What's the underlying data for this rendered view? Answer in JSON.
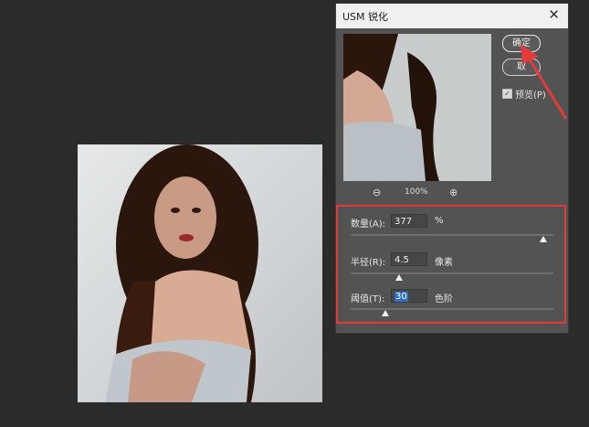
{
  "dialog": {
    "title": "USM 锐化",
    "close_icon": "close-icon",
    "ok_label": "确定",
    "cancel_label": "取",
    "preview_label": "预览(P)",
    "preview_checked": true,
    "zoom": "100%"
  },
  "params": {
    "amount": {
      "label": "数量(A):",
      "value": "377",
      "unit": "%",
      "slider_fraction": 0.95
    },
    "radius": {
      "label": "半径(R):",
      "value": "4.5",
      "unit": "像素",
      "slider_fraction": 0.24
    },
    "threshold": {
      "label": "阈值(T):",
      "value": "30",
      "unit": "色阶",
      "slider_fraction": 0.17
    }
  },
  "colors": {
    "highlight": "#e33b3b",
    "selection": "#2f6fc6",
    "dialog_bg": "#535353"
  }
}
